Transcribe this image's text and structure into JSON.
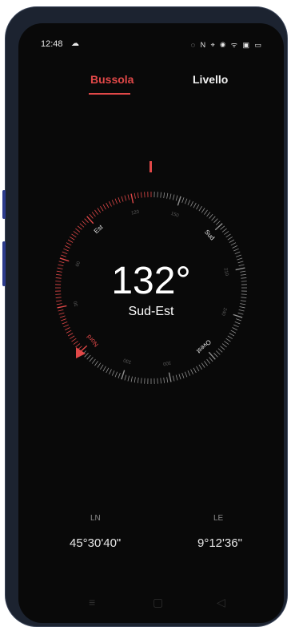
{
  "status_bar": {
    "time": "12:48",
    "cloud_icon": "cloud-icon",
    "right_icons": "◌ N ⌖ ◉ ᯤ ▣ ▭"
  },
  "tabs": [
    {
      "label": "Bussola",
      "active": true
    },
    {
      "label": "Livello",
      "active": false
    }
  ],
  "compass": {
    "heading_deg": 132,
    "reading": "132°",
    "direction": "Sud-Est",
    "cardinals": [
      "Nord",
      "Est",
      "Sud",
      "Ovest"
    ],
    "degree_labels": [
      "30",
      "60",
      "120",
      "150",
      "210",
      "240",
      "300",
      "330"
    ],
    "accent": "#e04848"
  },
  "coordinates": {
    "lat_label": "LN",
    "lat_value": "45°30'40\"",
    "lon_label": "LE",
    "lon_value": "9°12'36\""
  },
  "navbar": {
    "menu_icon": "menu-icon",
    "home_icon": "home-icon",
    "back_icon": "back-icon"
  }
}
